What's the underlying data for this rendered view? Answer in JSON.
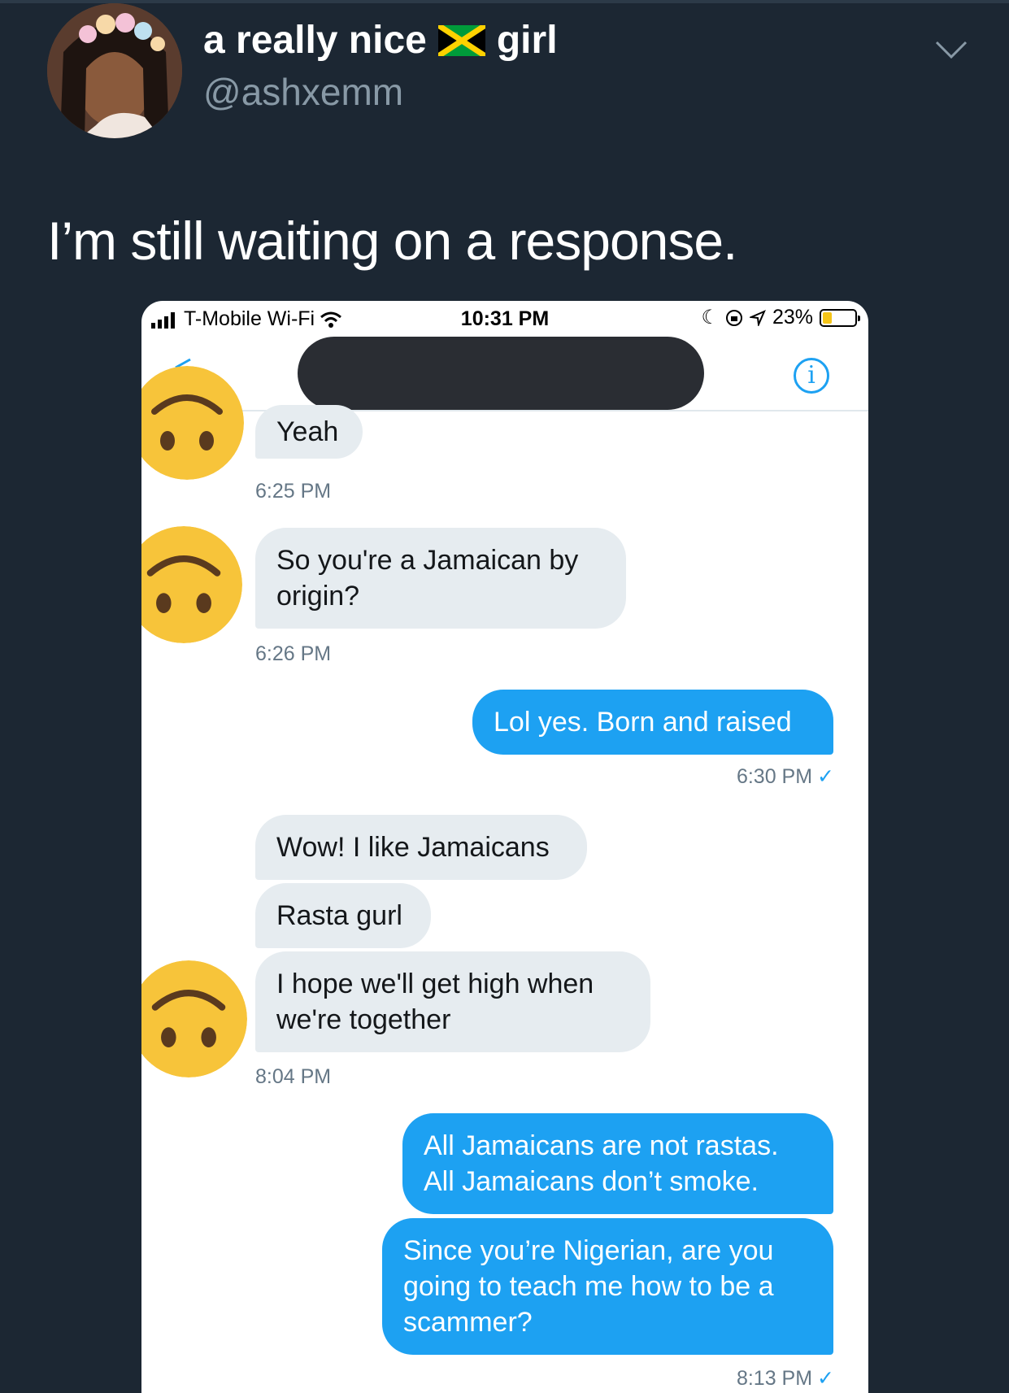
{
  "tweet": {
    "display_name_left": "a really nice",
    "display_name_right": "girl",
    "handle": "@ashxemm",
    "text": "I’m still waiting on a response.",
    "flag_icon": "jamaica-flag-icon",
    "caret_icon": "chevron-down-icon"
  },
  "screenshot": {
    "status_bar": {
      "carrier": "T-Mobile Wi-Fi",
      "time": "10:31 PM",
      "battery": "23%"
    },
    "conversation": {
      "messages": [
        {
          "from": "them",
          "text": "Yeah",
          "time": "6:25 PM"
        },
        {
          "from": "them",
          "text": "So you're a Jamaican by\norigin?",
          "time": "6:26 PM"
        },
        {
          "from": "me",
          "text": "Lol yes. Born and raised",
          "time": "6:30 PM"
        },
        {
          "from": "them",
          "text": "Wow! I like Jamaicans"
        },
        {
          "from": "them",
          "text": "Rasta gurl"
        },
        {
          "from": "them",
          "text": "I hope we'll get high when\nwe're together",
          "time": "8:04 PM"
        },
        {
          "from": "me",
          "text": "All Jamaicans are not rastas.\nAll Jamaicans don’t smoke."
        },
        {
          "from": "me",
          "text": "Since you’re Nigerian, are you\ngoing to teach me how to be a\nscammer?",
          "time": "8:13 PM"
        }
      ],
      "read_mark": "✓"
    }
  }
}
